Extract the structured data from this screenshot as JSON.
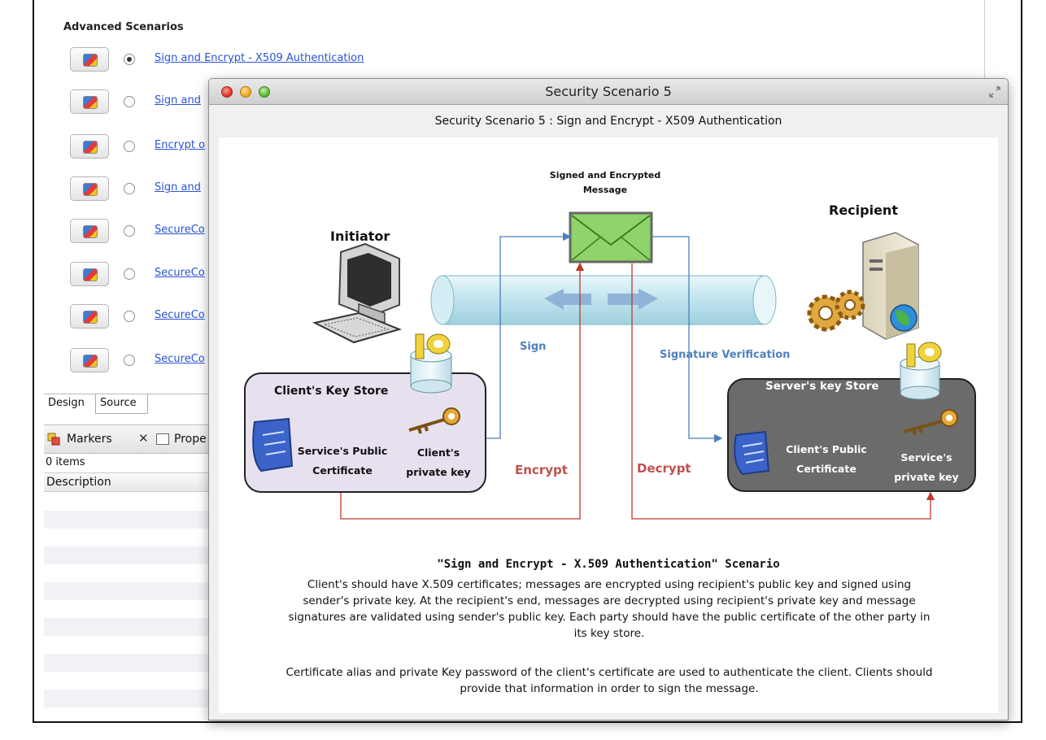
{
  "background": {
    "section_title": "Advanced Scenarios",
    "scenarios": [
      {
        "label": "Sign and Encrypt - X509 Authentication",
        "selected": true
      },
      {
        "label": "Sign and",
        "selected": false
      },
      {
        "label": "Encrypt o",
        "selected": false
      },
      {
        "label": "Sign and",
        "selected": false
      },
      {
        "label": "SecureCo",
        "selected": false
      },
      {
        "label": "SecureCo",
        "selected": false
      },
      {
        "label": "SecureCo",
        "selected": false
      },
      {
        "label": "SecureCo",
        "selected": false
      }
    ],
    "editor_tabs": {
      "design": "Design",
      "source": "Source"
    },
    "markers": {
      "label": "Markers",
      "close": "✕",
      "properties": "Prope",
      "count": "0 items",
      "column": "Description"
    }
  },
  "modal": {
    "title": "Security Scenario 5",
    "subtitle": "Security Scenario 5 : Sign and Encrypt - X509 Authentication",
    "diagram": {
      "message_label_1": "Signed and Encrypted",
      "message_label_2": "Message",
      "initiator": "Initiator",
      "recipient": "Recipient",
      "sign": "Sign",
      "signature_verification": "Signature Verification",
      "client_store": "Client's Key Store",
      "service_public_cert_1": "Service's Public",
      "service_public_cert_2": "Certificate",
      "client_private_key_1": "Client's",
      "client_private_key_2": "private key",
      "encrypt": "Encrypt",
      "decrypt": "Decrypt",
      "server_store": "Server's key Store",
      "client_public_cert_1": "Client's Public",
      "client_public_cert_2": "Certificate",
      "service_private_key_1": "Service's",
      "service_private_key_2": "private key"
    },
    "description": {
      "title": "\"Sign and Encrypt - X.509 Authentication\" Scenario",
      "p1": "Client's should have X.509 certificates; messages are encrypted using recipient's public key and signed using sender's private key. At the recipient's end, messages are decrypted using recipient's private key and message signatures are validated using sender's public key. Each party should have the public certificate of the other party in its key store.",
      "p2": "Certificate alias and private Key password of the client's certificate are used to authenticate the client. Clients should provide that information in order to sign the message."
    }
  },
  "colors": {
    "link": "#2a52d8",
    "sign_line": "#4a7fc0",
    "encrypt_line": "#c0392b",
    "encrypt_text": "#c0504d",
    "sign_text": "#4f81bd",
    "envelope": "#8fd36a",
    "client_store_fill": "#e7e1ef",
    "server_store_fill": "#6b6b6b"
  },
  "icons": [
    "scenario-icon",
    "radio-icon",
    "markers-icon",
    "properties-icon",
    "close-icon",
    "resize-icon",
    "computer-icon",
    "server-icon",
    "gears-icon",
    "globe-icon",
    "envelope-icon",
    "key-icon",
    "certificate-icon",
    "keystore-icon",
    "arrow-left-icon",
    "arrow-right-icon"
  ]
}
